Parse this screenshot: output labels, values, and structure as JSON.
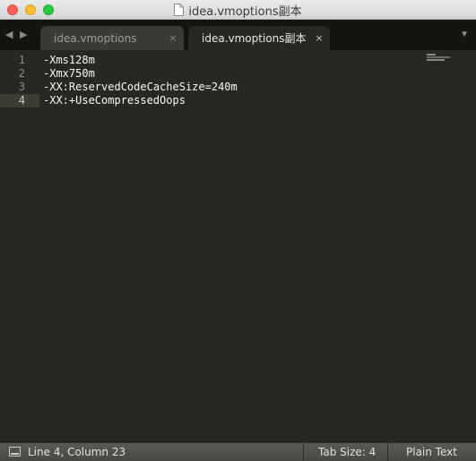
{
  "window": {
    "title": "idea.vmoptions副本"
  },
  "tabbar": {
    "back_icon": "◀",
    "forward_icon": "▶",
    "dropdown_icon": "▼",
    "tabs": [
      {
        "label": "idea.vmoptions",
        "close": "×",
        "active": false
      },
      {
        "label": "idea.vmoptions副本",
        "close": "×",
        "active": true
      }
    ]
  },
  "editor": {
    "line_numbers": [
      "1",
      "2",
      "3",
      "4"
    ],
    "lines": [
      "-Xms128m",
      "-Xmx750m",
      "-XX:ReservedCodeCacheSize=240m",
      "-XX:+UseCompressedOops"
    ],
    "current_line": 4
  },
  "statusbar": {
    "position": "Line 4, Column 23",
    "tab_size": "Tab Size: 4",
    "syntax": "Plain Text"
  },
  "colors": {
    "editor_bg": "#272822",
    "tabbar_bg": "#141411",
    "text": "#f8f8f2",
    "close_btn": "#fc5f57",
    "minimize_btn": "#fdbb2e",
    "maximize_btn": "#28c840"
  }
}
